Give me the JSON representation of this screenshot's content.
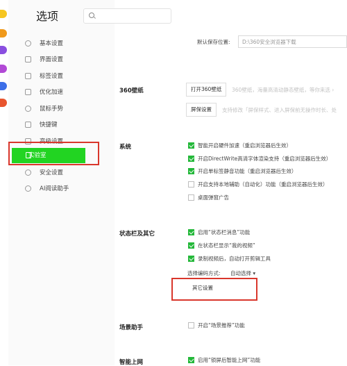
{
  "app": {
    "title": "选项"
  },
  "search": {
    "placeholder": ""
  },
  "left_strip": {
    "icons": [
      {
        "name": "app-icon-yellow",
        "color": "#f6c621"
      },
      {
        "name": "app-icon-orange",
        "color": "#f09a1c"
      },
      {
        "name": "app-icon-purple",
        "color": "#8a4fe0"
      },
      {
        "name": "app-icon-violet",
        "color": "#b24ad6"
      },
      {
        "name": "app-icon-blue",
        "color": "#3d6fe8"
      },
      {
        "name": "app-icon-red",
        "color": "#e8552e"
      }
    ]
  },
  "sidebar": {
    "items": [
      {
        "label": "基本设置",
        "icon": "gear-icon"
      },
      {
        "label": "界面设置",
        "icon": "window-icon"
      },
      {
        "label": "标签设置",
        "icon": "tab-icon"
      },
      {
        "label": "优化加速",
        "icon": "lightning-icon"
      },
      {
        "label": "鼠标手势",
        "icon": "mouse-icon"
      },
      {
        "label": "快捷键",
        "icon": "keyboard-icon"
      },
      {
        "label": "高级设置",
        "icon": "tools-icon"
      },
      {
        "label": "实验室",
        "icon": "flask-icon",
        "active": true
      },
      {
        "label": "安全设置",
        "icon": "shield-icon"
      },
      {
        "label": "AI阅读助手",
        "icon": "ai-reader-icon"
      }
    ]
  },
  "download": {
    "label": "默认保存位置:",
    "path": "D:\\360安全浏览器下载"
  },
  "wallpaper": {
    "section": "360壁纸",
    "open_button": "打开360壁纸",
    "open_desc": "360壁纸，海量高清动静态壁纸，等你来选 ›",
    "screensaver_button": "屏保设置",
    "screensaver_desc": "支持修改「屏保样式、进入屏保前无操作时长、处"
  },
  "system": {
    "section": "系统",
    "options": [
      {
        "label": "智能开启硬件加速（重启浏览器后生效）",
        "checked": true
      },
      {
        "label": "开启DirectWrite高清字体渲染支持（重启浏览器后生效）",
        "checked": true
      },
      {
        "label": "开启单标签静音功能（重启浏览器后生效）",
        "checked": true
      },
      {
        "label": "开启支持本地辅助（自动化）功能（重启浏览器后生效）",
        "checked": false
      },
      {
        "label": "桌面弹窗广告",
        "checked": false
      }
    ]
  },
  "statusbar": {
    "section": "状态栏及其它",
    "options": [
      {
        "label": "启用“状态栏消息”功能",
        "checked": true
      },
      {
        "label": "在状态栏显示“我的视频”",
        "checked": true
      },
      {
        "label": "录制视频后，自动打开剪辑工具",
        "checked": true
      }
    ],
    "encoding_label": "选择编码方式:",
    "encoding_value": "自动选择",
    "other_button": "其它设置"
  },
  "scene": {
    "section": "场景助手",
    "options": [
      {
        "label": "开启“场景推荐”功能",
        "checked": false
      }
    ]
  },
  "smart": {
    "section": "智能上网",
    "options": [
      {
        "label": "启用“锁屏后智能上网”功能",
        "checked": true
      }
    ]
  }
}
